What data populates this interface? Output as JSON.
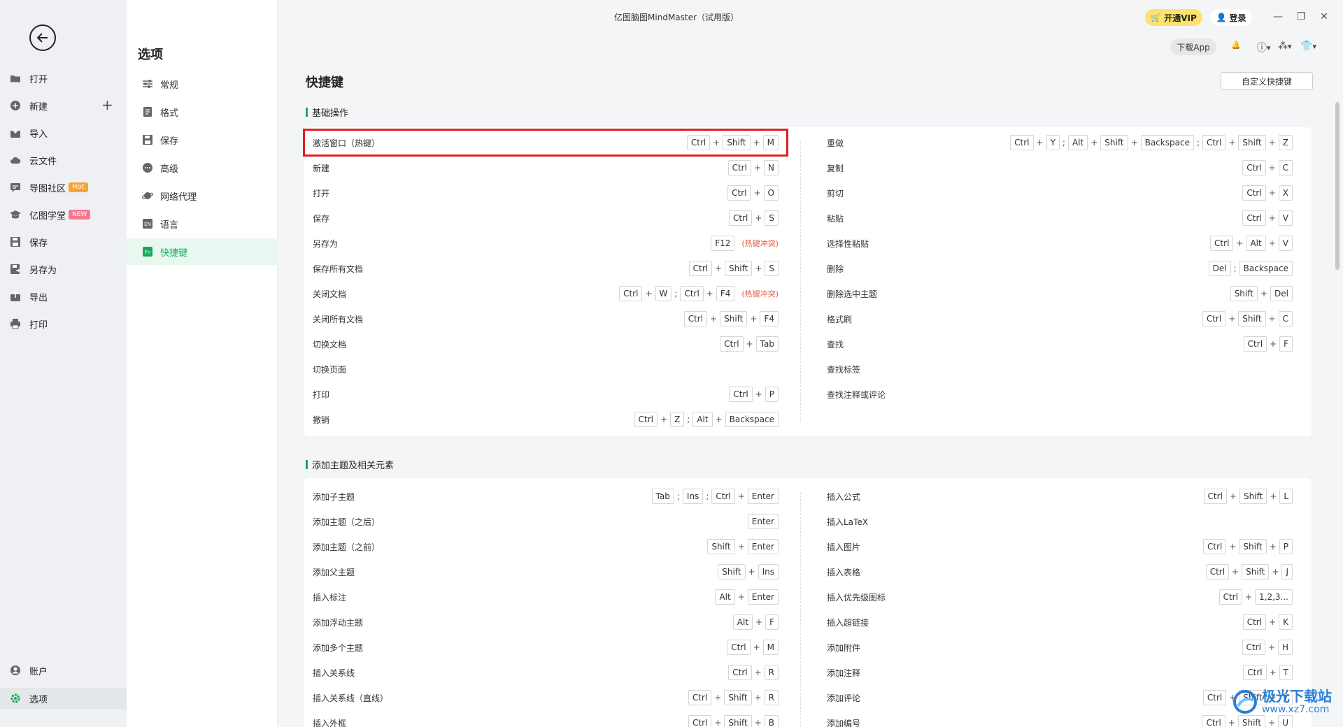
{
  "window_title": "亿图脑图MindMaster（试用版）",
  "top_bar": {
    "vip_label": "开通VIP",
    "login_label": "登录",
    "download_app": "下载App"
  },
  "left_nav": {
    "items": [
      {
        "label": "打开",
        "icon": "folder-icon"
      },
      {
        "label": "新建",
        "icon": "plus-circle-icon"
      },
      {
        "label": "导入",
        "icon": "import-icon"
      },
      {
        "label": "云文件",
        "icon": "cloud-icon"
      },
      {
        "label": "导图社区",
        "icon": "community-icon",
        "badge": "Hot"
      },
      {
        "label": "亿图学堂",
        "icon": "graduation-cap-icon",
        "badge": "NEW"
      },
      {
        "label": "保存",
        "icon": "save-icon"
      },
      {
        "label": "另存为",
        "icon": "save-as-icon"
      },
      {
        "label": "导出",
        "icon": "export-icon"
      },
      {
        "label": "打印",
        "icon": "printer-icon"
      }
    ],
    "account_label": "账户",
    "options_label": "选项"
  },
  "options_panel": {
    "title": "选项",
    "items": [
      {
        "label": "常规",
        "icon": "sliders-icon"
      },
      {
        "label": "格式",
        "icon": "format-icon"
      },
      {
        "label": "保存",
        "icon": "save-icon"
      },
      {
        "label": "高级",
        "icon": "more-icon"
      },
      {
        "label": "网络代理",
        "icon": "planet-icon"
      },
      {
        "label": "语言",
        "icon": "language-icon"
      },
      {
        "label": "快捷键",
        "icon": "hotkey-icon",
        "active": true
      }
    ]
  },
  "page": {
    "title": "快捷键",
    "custom_button": "自定义快捷键",
    "conflict_text": "(热键冲突)",
    "sections": [
      {
        "title": "基础操作",
        "left": [
          {
            "label": "激活窗口（热键）",
            "keys": [
              [
                "Ctrl",
                "Shift",
                "M"
              ]
            ],
            "highlight": true
          },
          {
            "label": "新建",
            "keys": [
              [
                "Ctrl",
                "N"
              ]
            ]
          },
          {
            "label": "打开",
            "keys": [
              [
                "Ctrl",
                "O"
              ]
            ]
          },
          {
            "label": "保存",
            "keys": [
              [
                "Ctrl",
                "S"
              ]
            ]
          },
          {
            "label": "另存为",
            "keys": [
              [
                "F12"
              ]
            ],
            "conflict": true
          },
          {
            "label": "保存所有文档",
            "keys": [
              [
                "Ctrl",
                "Shift",
                "S"
              ]
            ]
          },
          {
            "label": "关闭文档",
            "keys": [
              [
                "Ctrl",
                "W"
              ],
              [
                "Ctrl",
                "F4"
              ]
            ],
            "conflict": true
          },
          {
            "label": "关闭所有文档",
            "keys": [
              [
                "Ctrl",
                "Shift",
                "F4"
              ]
            ]
          },
          {
            "label": "切换文档",
            "keys": [
              [
                "Ctrl",
                "Tab"
              ]
            ]
          },
          {
            "label": "切换页面",
            "keys": []
          },
          {
            "label": "打印",
            "keys": [
              [
                "Ctrl",
                "P"
              ]
            ]
          },
          {
            "label": "撤销",
            "keys": [
              [
                "Ctrl",
                "Z"
              ],
              [
                "Alt",
                "Backspace"
              ]
            ]
          }
        ],
        "right": [
          {
            "label": "重做",
            "keys": [
              [
                "Ctrl",
                "Y"
              ],
              [
                "Alt",
                "Shift",
                "Backspace"
              ],
              [
                "Ctrl",
                "Shift",
                "Z"
              ]
            ]
          },
          {
            "label": "复制",
            "keys": [
              [
                "Ctrl",
                "C"
              ]
            ]
          },
          {
            "label": "剪切",
            "keys": [
              [
                "Ctrl",
                "X"
              ]
            ]
          },
          {
            "label": "粘贴",
            "keys": [
              [
                "Ctrl",
                "V"
              ]
            ]
          },
          {
            "label": "选择性粘贴",
            "keys": [
              [
                "Ctrl",
                "Alt",
                "V"
              ]
            ]
          },
          {
            "label": "删除",
            "keys": [
              [
                "Del"
              ],
              [
                "Backspace"
              ]
            ]
          },
          {
            "label": "删除选中主题",
            "keys": [
              [
                "Shift",
                "Del"
              ]
            ]
          },
          {
            "label": "格式刷",
            "keys": [
              [
                "Ctrl",
                "Shift",
                "C"
              ]
            ]
          },
          {
            "label": "查找",
            "keys": [
              [
                "Ctrl",
                "F"
              ]
            ]
          },
          {
            "label": "查找标签",
            "keys": []
          },
          {
            "label": "查找注释或评论",
            "keys": []
          }
        ]
      },
      {
        "title": "添加主题及相关元素",
        "left": [
          {
            "label": "添加子主题",
            "keys": [
              [
                "Tab"
              ],
              [
                "Ins"
              ],
              [
                "Ctrl",
                "Enter"
              ]
            ]
          },
          {
            "label": "添加主题（之后）",
            "keys": [
              [
                "Enter"
              ]
            ]
          },
          {
            "label": "添加主题（之前）",
            "keys": [
              [
                "Shift",
                "Enter"
              ]
            ]
          },
          {
            "label": "添加父主题",
            "keys": [
              [
                "Shift",
                "Ins"
              ]
            ]
          },
          {
            "label": "插入标注",
            "keys": [
              [
                "Alt",
                "Enter"
              ]
            ]
          },
          {
            "label": "添加浮动主题",
            "keys": [
              [
                "Alt",
                "F"
              ]
            ]
          },
          {
            "label": "添加多个主题",
            "keys": [
              [
                "Ctrl",
                "M"
              ]
            ]
          },
          {
            "label": "插入关系线",
            "keys": [
              [
                "Ctrl",
                "R"
              ]
            ]
          },
          {
            "label": "插入关系线（直线）",
            "keys": [
              [
                "Ctrl",
                "Shift",
                "R"
              ]
            ]
          },
          {
            "label": "插入外框",
            "keys": [
              [
                "Ctrl",
                "Shift",
                "B"
              ]
            ]
          }
        ],
        "right": [
          {
            "label": "插入公式",
            "keys": [
              [
                "Ctrl",
                "Shift",
                "L"
              ]
            ]
          },
          {
            "label": "插入LaTeX",
            "keys": []
          },
          {
            "label": "插入图片",
            "keys": [
              [
                "Ctrl",
                "Shift",
                "P"
              ]
            ]
          },
          {
            "label": "插入表格",
            "keys": [
              [
                "Ctrl",
                "Shift",
                "J"
              ]
            ]
          },
          {
            "label": "插入优先级图标",
            "keys": [
              [
                "Ctrl",
                "1,2,3..."
              ]
            ]
          },
          {
            "label": "插入超链接",
            "keys": [
              [
                "Ctrl",
                "K"
              ]
            ]
          },
          {
            "label": "添加附件",
            "keys": [
              [
                "Ctrl",
                "H"
              ]
            ]
          },
          {
            "label": "添加注释",
            "keys": [
              [
                "Ctrl",
                "T"
              ]
            ]
          },
          {
            "label": "添加评论",
            "keys": [
              [
                "Ctrl",
                "Shift",
                "Y"
              ]
            ]
          },
          {
            "label": "添加编号",
            "keys": [
              [
                "Ctrl",
                "Shift",
                "U"
              ]
            ]
          }
        ]
      }
    ]
  },
  "watermark": {
    "name": "极光下载站",
    "url": "www.xz7.com"
  },
  "colors": {
    "accent_green": "#1aa858",
    "highlight_red": "#e01e24",
    "vip_yellow": "#fde36c",
    "conflict_orange": "#e85b3a"
  }
}
